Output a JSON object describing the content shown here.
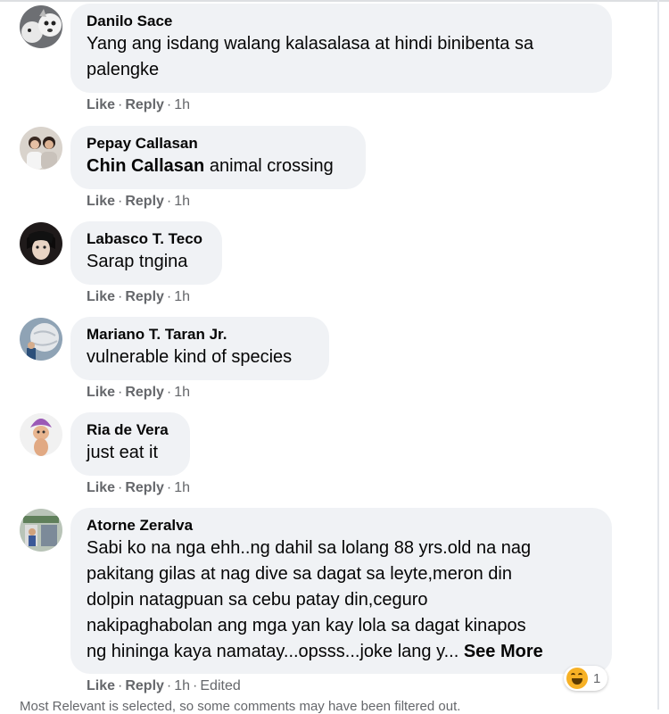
{
  "comments": [
    {
      "author": "Danilo Sace",
      "lines": [
        "Yang ang isdang walang kalasalasa at hindi binibenta sa",
        "palengke"
      ],
      "like": "Like",
      "reply": "Reply",
      "time": "1h",
      "avatar_icon": "dog-photo-avatar-icon"
    },
    {
      "author": "Pepay Callasan",
      "mention": "Chin Callasan",
      "text": " animal crossing",
      "like": "Like",
      "reply": "Reply",
      "time": "1h",
      "avatar_icon": "family-photo-avatar-icon"
    },
    {
      "author": "Labasco T. Teco",
      "lines": [
        "Sarap tngina"
      ],
      "like": "Like",
      "reply": "Reply",
      "time": "1h",
      "avatar_icon": "anime-avatar-icon"
    },
    {
      "author": "Mariano T. Taran Jr.",
      "lines": [
        "vulnerable kind of species"
      ],
      "like": "Like",
      "reply": "Reply",
      "time": "1h",
      "avatar_icon": "globe-photo-avatar-icon"
    },
    {
      "author": "Ria de Vera",
      "lines": [
        "just eat it"
      ],
      "like": "Like",
      "reply": "Reply",
      "time": "1h",
      "avatar_icon": "troll-doll-avatar-icon"
    },
    {
      "author": "Atorne Zeralva",
      "lines": [
        "Sabi ko na nga ehh..ng dahil sa lolang 88 yrs.old na nag",
        "pakitang gilas at nag dive sa dagat sa leyte,meron din",
        "dolpin natagpuan sa cebu patay din,ceguro",
        "nakipaghabolan ang mga yan kay lola sa dagat kinapos",
        "ng hininga kaya namatay...opsss...joke lang y..."
      ],
      "see_more": "See More",
      "like": "Like",
      "reply": "Reply",
      "time": "1h",
      "edited": "Edited",
      "reaction_count": "1",
      "avatar_icon": "shop-photo-avatar-icon"
    }
  ],
  "footer_text": "Most Relevant is selected, so some comments may have been filtered out.",
  "colors": {
    "bubble": "#f0f2f5",
    "meta": "#65676b",
    "haha": "#f7b125"
  }
}
